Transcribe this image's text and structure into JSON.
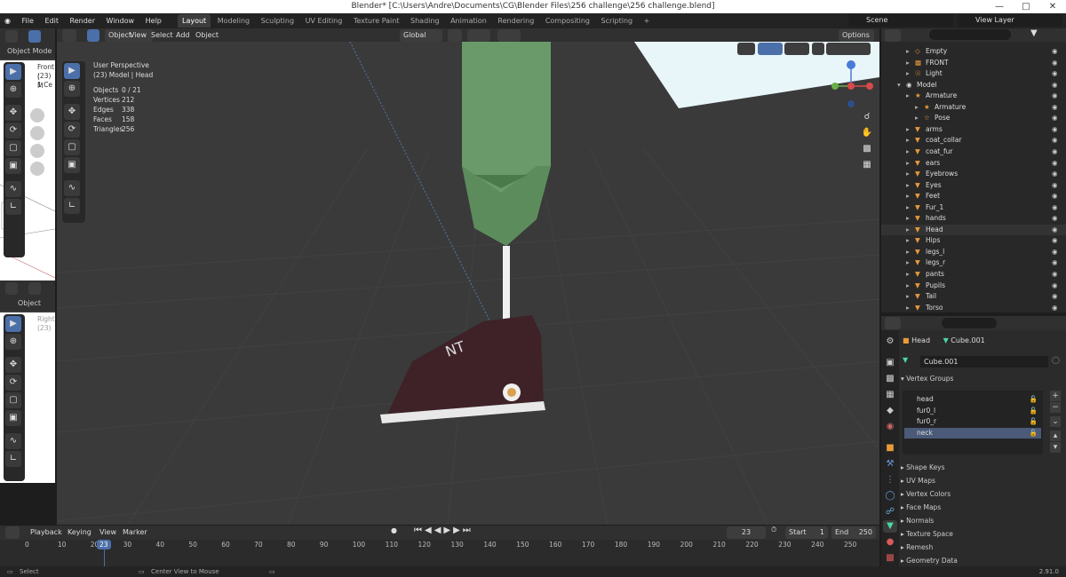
{
  "window": {
    "title": "Blender* [C:\\Users\\Andre\\Documents\\CG\\Blender Files\\256 challenge\\256 challenge.blend]"
  },
  "menu": [
    "File",
    "Edit",
    "Render",
    "Window",
    "Help"
  ],
  "workspaces": [
    {
      "label": "Layout",
      "active": true
    },
    {
      "label": "Modeling"
    },
    {
      "label": "Sculpting"
    },
    {
      "label": "UV Editing"
    },
    {
      "label": "Texture Paint"
    },
    {
      "label": "Shading"
    },
    {
      "label": "Animation"
    },
    {
      "label": "Rendering"
    },
    {
      "label": "Compositing"
    },
    {
      "label": "Scripting"
    }
  ],
  "add_workspace": "+",
  "scene": {
    "label": "Scene"
  },
  "view_layer": {
    "label": "View Layer"
  },
  "viewport_header": {
    "mode": "Object Mode",
    "menus": [
      "View",
      "Select",
      "Add",
      "Object"
    ],
    "transform": "Global",
    "options": "Options"
  },
  "side_views": {
    "top": {
      "mode": "Object Mode",
      "label1": "Front (",
      "label2": "(23) M",
      "label3": "1 Ce"
    },
    "bottom": {
      "mode": "Object Mode",
      "label1": "Right",
      "label2": "(23)"
    }
  },
  "viewport_info": {
    "perspective": "User Perspective",
    "context": "(23) Model | Head",
    "stats": [
      {
        "label": "Objects",
        "value": "0 / 21"
      },
      {
        "label": "Vertices",
        "value": "212"
      },
      {
        "label": "Edges",
        "value": "338"
      },
      {
        "label": "Faces",
        "value": "158"
      },
      {
        "label": "Triangles",
        "value": "256"
      }
    ]
  },
  "outliner": {
    "rows": [
      {
        "label": "Empty",
        "indent": 1
      },
      {
        "label": "FRONT",
        "indent": 1
      },
      {
        "label": "Light",
        "indent": 1
      },
      {
        "label": "Model",
        "indent": 0
      },
      {
        "label": "Armature",
        "indent": 1
      },
      {
        "label": "Armature",
        "indent": 2
      },
      {
        "label": "Pose",
        "indent": 2
      },
      {
        "label": "arms",
        "indent": 1
      },
      {
        "label": "coat_collar",
        "indent": 1
      },
      {
        "label": "coat_fur",
        "indent": 1
      },
      {
        "label": "ears",
        "indent": 1
      },
      {
        "label": "Eyebrows",
        "indent": 1
      },
      {
        "label": "Eyes",
        "indent": 1
      },
      {
        "label": "Feet",
        "indent": 1
      },
      {
        "label": "Fur_1",
        "indent": 1
      },
      {
        "label": "hands",
        "indent": 1
      },
      {
        "label": "Head",
        "indent": 1
      },
      {
        "label": "Hips",
        "indent": 1
      },
      {
        "label": "legs_l",
        "indent": 1
      },
      {
        "label": "legs_r",
        "indent": 1
      },
      {
        "label": "pants",
        "indent": 1
      },
      {
        "label": "Pupils",
        "indent": 1
      },
      {
        "label": "Tail",
        "indent": 1
      },
      {
        "label": "Torso",
        "indent": 1
      }
    ]
  },
  "properties": {
    "object": "Head",
    "mesh": "Cube.001",
    "mesh_field": "Cube.001",
    "vertex_groups_title": "Vertex Groups",
    "vertex_groups": [
      "head",
      "fur0_l",
      "fur0_r",
      "neck"
    ],
    "selected_group": "neck",
    "panels": [
      "Shape Keys",
      "UV Maps",
      "Vertex Colors",
      "Face Maps",
      "Normals",
      "Texture Space",
      "Remesh",
      "Geometry Data"
    ]
  },
  "timeline": {
    "menus": [
      "Playback",
      "Keying",
      "View",
      "Marker"
    ],
    "current_frame": "23",
    "start_label": "Start",
    "start": "1",
    "end_label": "End",
    "end": "250",
    "ruler": [
      "0",
      "10",
      "20",
      "30",
      "40",
      "50",
      "60",
      "70",
      "80",
      "90",
      "100",
      "110",
      "120",
      "130",
      "140",
      "150",
      "160",
      "170",
      "180",
      "190",
      "200",
      "210",
      "220",
      "230",
      "240",
      "250"
    ],
    "playhead": "23"
  },
  "status": {
    "select": "Select",
    "center": "Center View to Mouse",
    "version": "2.91.0"
  },
  "colors": {
    "accent": "#4b6fa8",
    "header": "#303030",
    "viewport": "#3a3a3a",
    "active_tab": "#3c3c3c"
  }
}
